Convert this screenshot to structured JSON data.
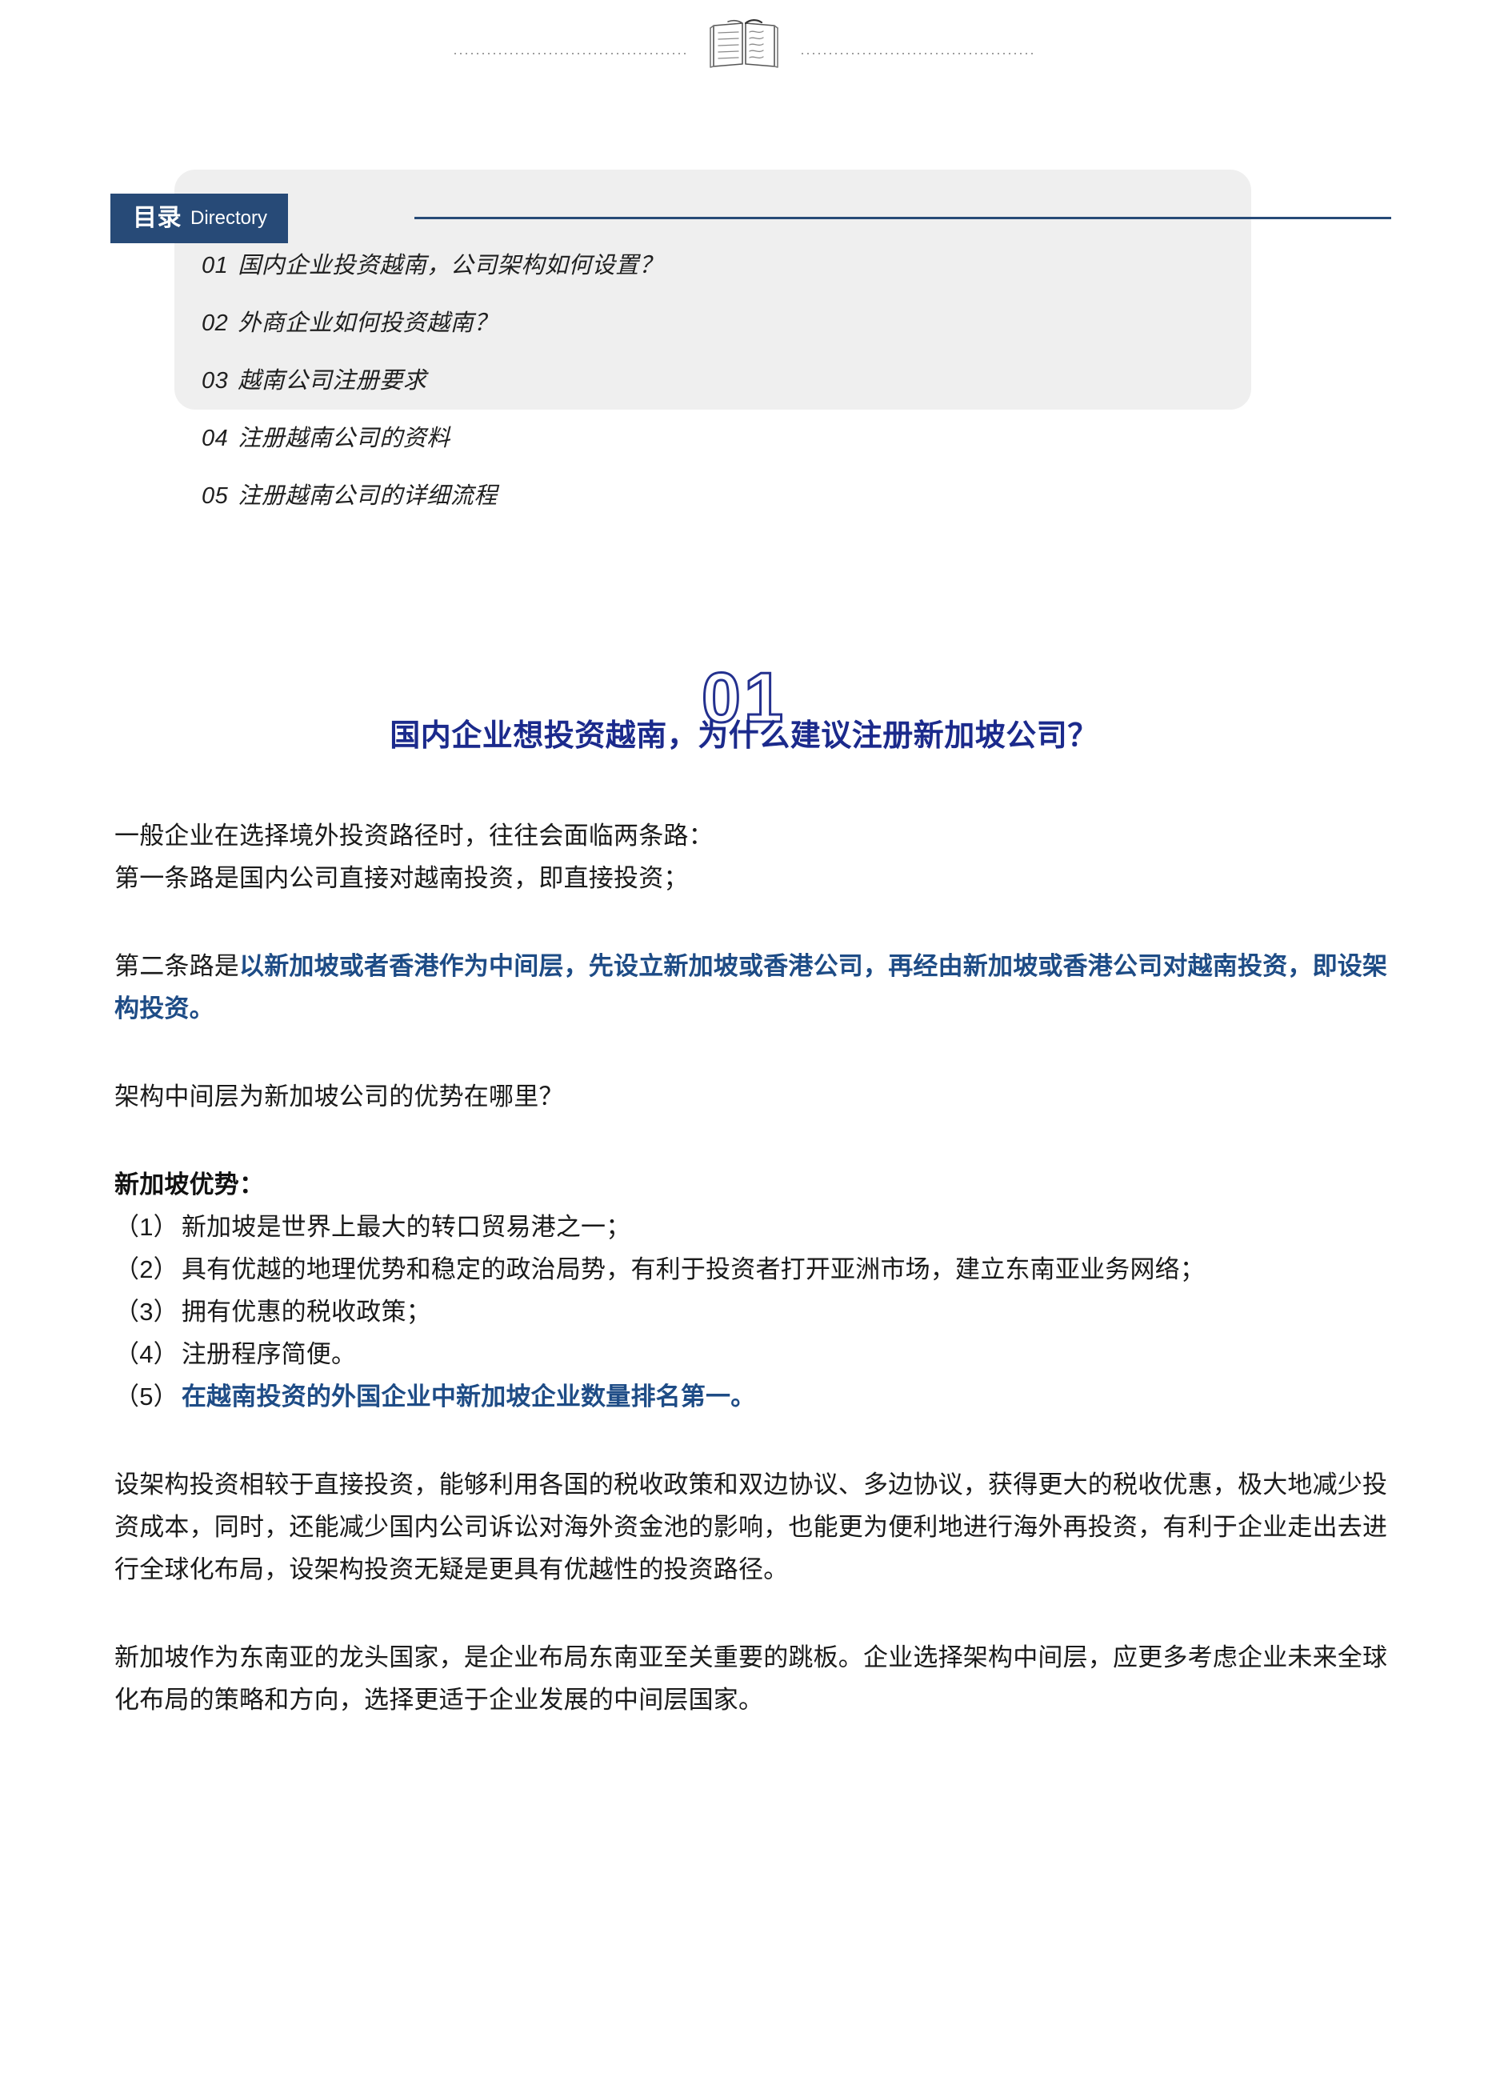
{
  "header": {
    "book_icon_name": "open-book-icon",
    "left_rule": "dotted-rule",
    "right_rule": "dotted-rule"
  },
  "directory": {
    "badge_cn": "目录",
    "badge_en": "Directory",
    "items": [
      {
        "num": "01",
        "text": "国内企业投资越南，公司架构如何设置？"
      },
      {
        "num": "02",
        "text": "外商企业如何投资越南？"
      },
      {
        "num": "03",
        "text": "越南公司注册要求"
      },
      {
        "num": "04",
        "text": "注册越南公司的资料"
      },
      {
        "num": "05",
        "text": "注册越南公司的详细流程"
      }
    ]
  },
  "section": {
    "watermark": "01",
    "title": "国内企业想投资越南，为什么建议注册新加坡公司？"
  },
  "body": {
    "p1_line1": "一般企业在选择境外投资路径时，往往会面临两条路：",
    "p1_line2": "第一条路是国内公司直接对越南投资，即直接投资；",
    "p2_lead": "第二条路是",
    "p2_emph": "以新加坡或者香港作为中间层，先设立新加坡或香港公司，再经由新加坡或香港公司对越南投资，即设架构投资。",
    "p3": "架构中间层为新加坡公司的优势在哪里？",
    "advantages_title": "新加坡优势：",
    "advantages": [
      {
        "label": "（1）",
        "text": "新加坡是世界上最大的转口贸易港之一；",
        "emphasis": false
      },
      {
        "label": "（2）",
        "text": "具有优越的地理优势和稳定的政治局势，有利于投资者打开亚洲市场，建立东南亚业务网络；",
        "emphasis": false
      },
      {
        "label": "（3）",
        "text": "拥有优惠的税收政策；",
        "emphasis": false
      },
      {
        "label": "（4）",
        "text": "注册程序简便。",
        "emphasis": false
      },
      {
        "label": "（5）",
        "text": "在越南投资的外国企业中新加坡企业数量排名第一。",
        "emphasis": true
      }
    ],
    "p4": "设架构投资相较于直接投资，能够利用各国的税收政策和双边协议、多边协议，获得更大的税收优惠，极大地减少投资成本，同时，还能减少国内公司诉讼对海外资金池的影响，也能更为便利地进行海外再投资，有利于企业走出去进行全球化布局，设架构投资无疑是更具有优越性的投资路径。",
    "p5": "新加坡作为东南亚的龙头国家，是企业布局东南亚至关重要的跳板。企业选择架构中间层，应更多考虑企业未来全球化布局的策略和方向，选择更适于企业发展的中间层国家。"
  },
  "colors": {
    "badge_navy": "#274a77",
    "heading_blue": "#1b2a8c",
    "emphasis_blue": "#1e4c86",
    "card_gray": "#efefef"
  }
}
